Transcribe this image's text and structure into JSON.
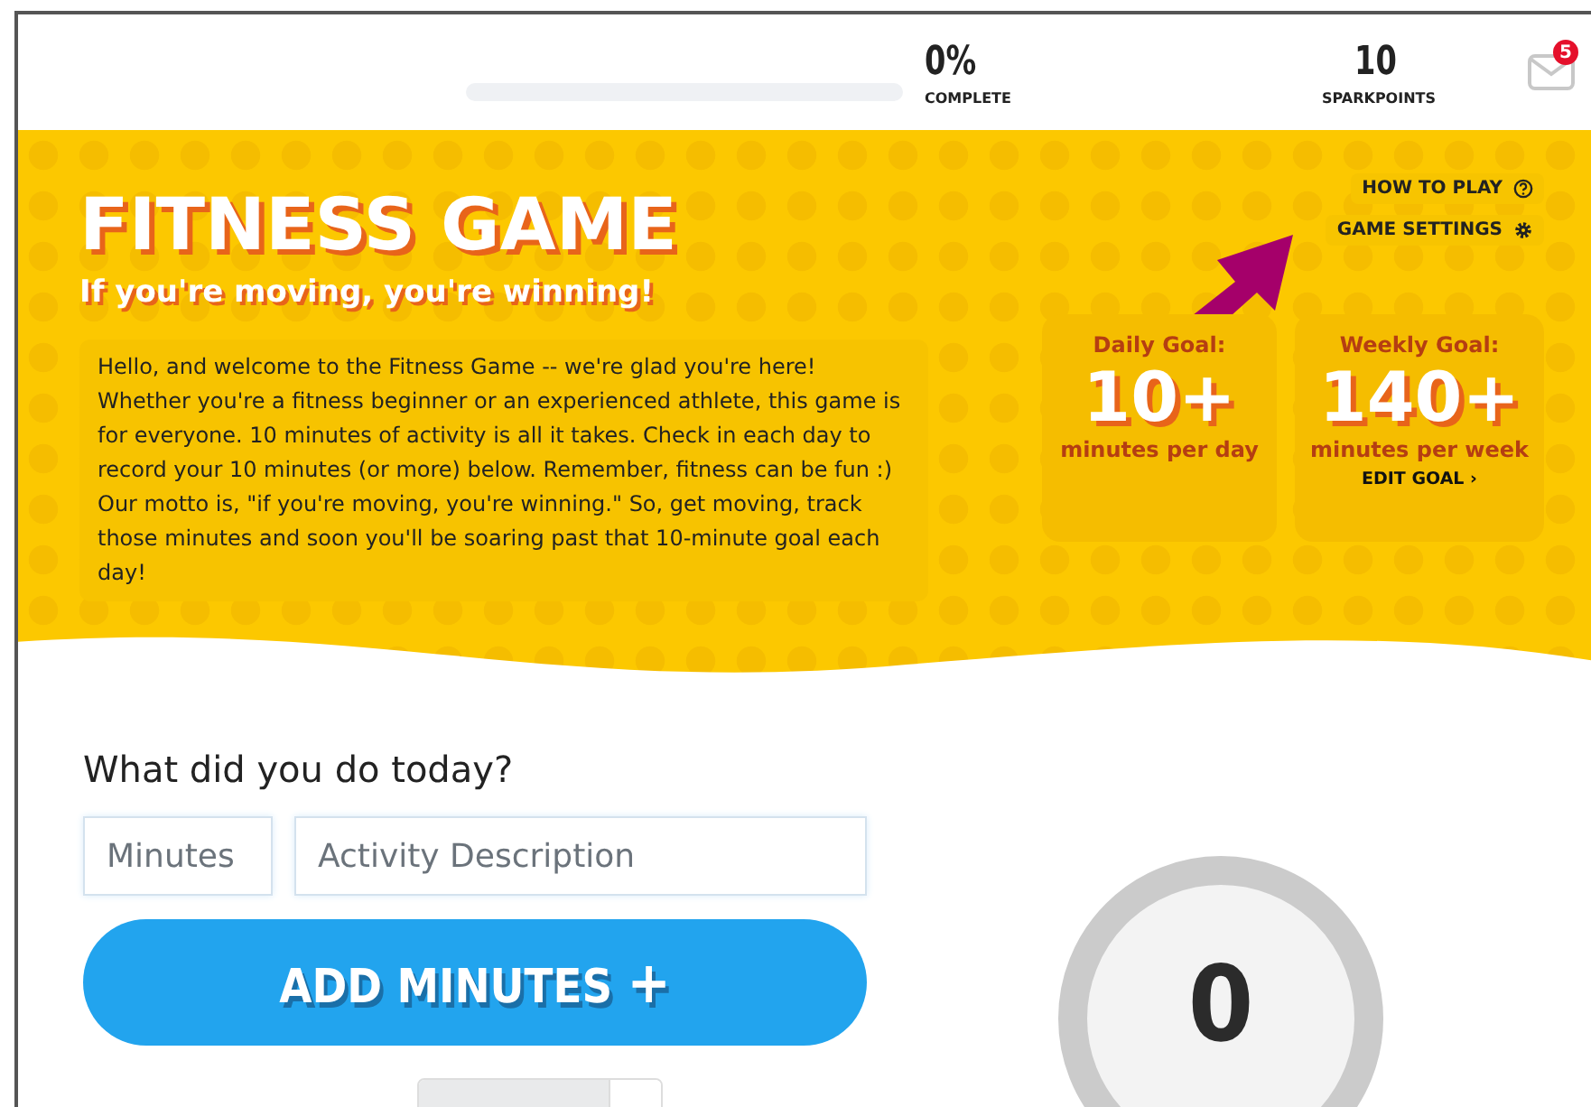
{
  "header": {
    "progress": {
      "level": 0
    },
    "complete": {
      "value": "0%",
      "label": "COMPLETE"
    },
    "sparkpoints": {
      "value": "10",
      "label": "SPARKPOINTS"
    },
    "messages": {
      "badge": "5"
    }
  },
  "banner": {
    "title": "FITNESS GAME",
    "subtitle": "If you're moving, you're winning!",
    "intro": "Hello, and welcome to the Fitness Game -- we're glad you're here! Whether you're a fitness beginner or an experienced athlete, this game is for everyone. 10 minutes of activity is all it takes. Check in each day to record your 10 minutes (or more) below. Remember, fitness can be fun :) Our motto is, \"if you're moving, you're winning.\" So, get moving, track those minutes and soon you'll be soaring past that 10-minute goal each day!",
    "links": [
      {
        "label": "HOW TO PLAY",
        "kind": "help"
      },
      {
        "label": "GAME SETTINGS",
        "kind": "settings"
      }
    ],
    "goals": [
      {
        "label": "Daily Goal:",
        "value": "10+",
        "unit": "minutes per day"
      },
      {
        "label": "Weekly Goal:",
        "value": "140+",
        "unit": "minutes per week",
        "link": "EDIT GOAL ›"
      }
    ]
  },
  "log": {
    "heading": "What did you do today?",
    "minutes": {
      "placeholder": "Minutes"
    },
    "activity": {
      "placeholder": "Activity Description"
    },
    "button": "ADD MINUTES",
    "button_icon": "+"
  },
  "tally": {
    "value": "0"
  }
}
